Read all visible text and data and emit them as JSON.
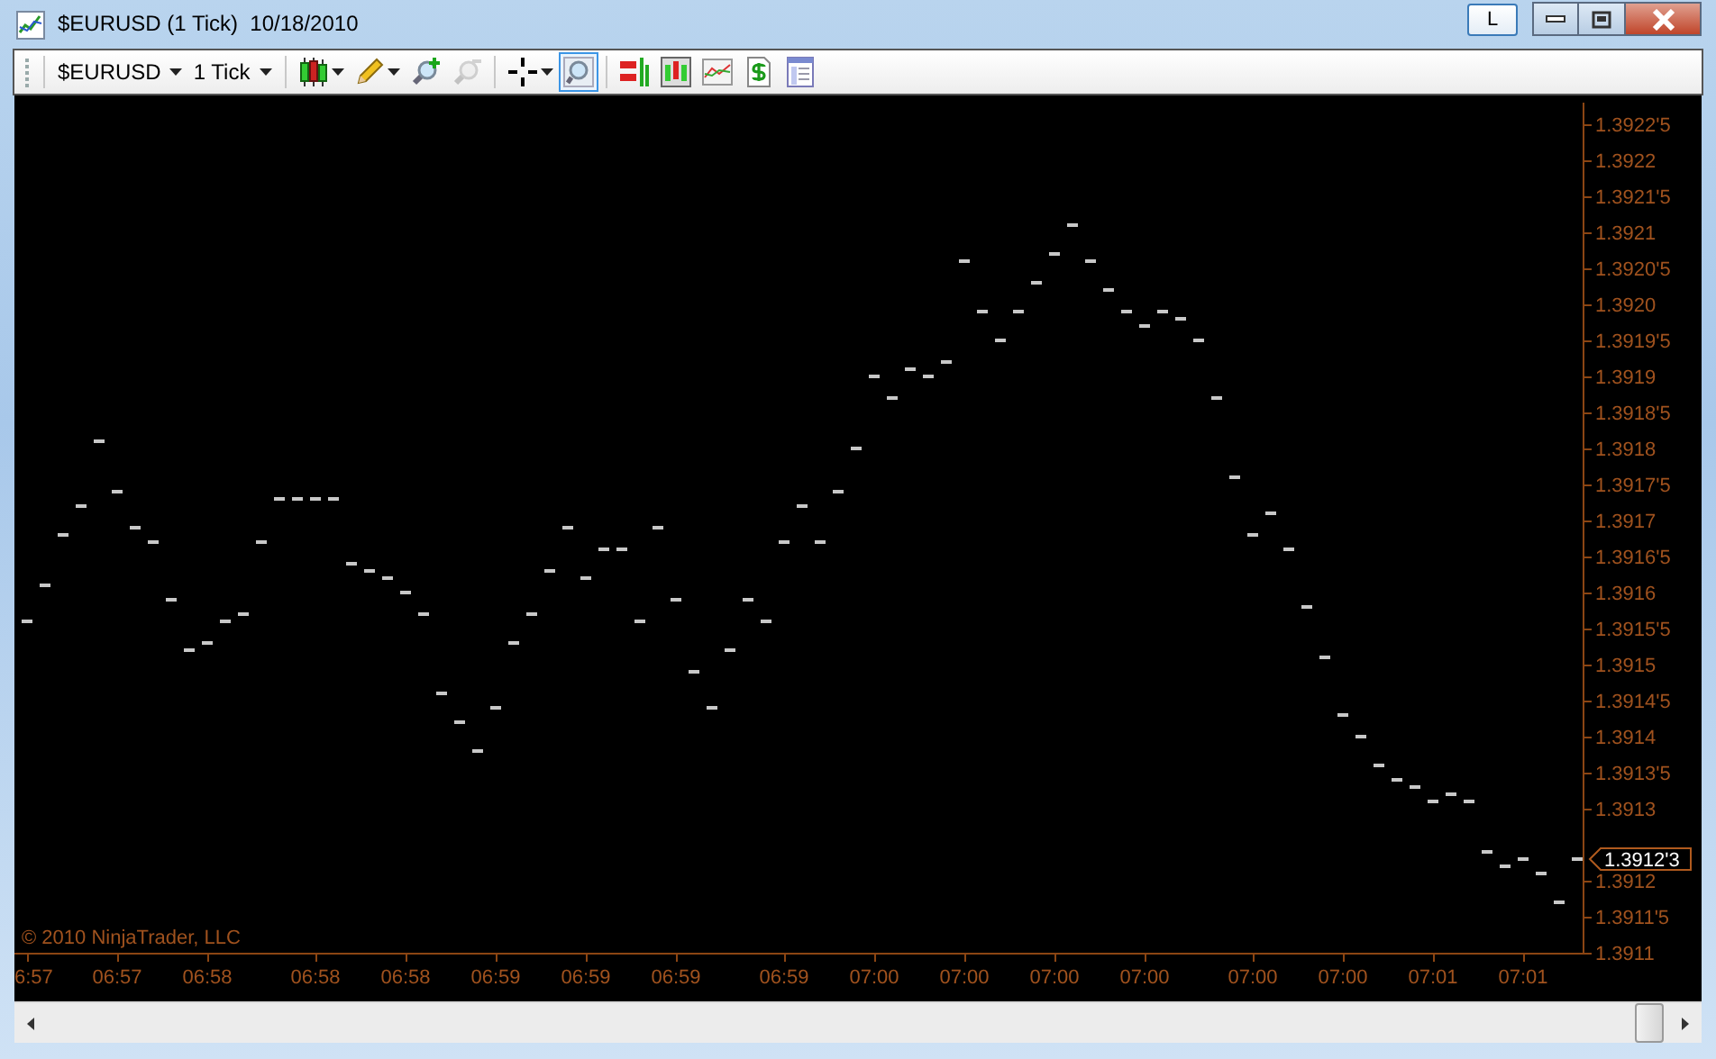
{
  "window": {
    "title": "$EURUSD (1 Tick)  10/18/2010",
    "link_button": "L"
  },
  "toolbar": {
    "instrument": "$EURUSD",
    "interval": "1 Tick",
    "tools": [
      {
        "kind": "candles",
        "menu": true,
        "disabled": false,
        "selected": false,
        "separator_before": true
      },
      {
        "kind": "pencil",
        "menu": true,
        "disabled": false,
        "selected": false,
        "separator_before": false
      },
      {
        "kind": "zoom-in",
        "menu": false,
        "disabled": false,
        "selected": false,
        "separator_before": false
      },
      {
        "kind": "zoom-out",
        "menu": false,
        "disabled": true,
        "selected": false,
        "separator_before": false
      },
      {
        "kind": "crosshair",
        "menu": true,
        "disabled": false,
        "selected": false,
        "separator_before": true
      },
      {
        "kind": "magnifier",
        "menu": false,
        "disabled": false,
        "selected": true,
        "separator_before": false
      },
      {
        "kind": "indicators",
        "menu": false,
        "disabled": false,
        "selected": false,
        "separator_before": true
      },
      {
        "kind": "strategies",
        "menu": false,
        "disabled": false,
        "selected": false,
        "separator_before": false
      },
      {
        "kind": "linechart",
        "menu": false,
        "disabled": false,
        "selected": false,
        "separator_before": false
      },
      {
        "kind": "dollar",
        "menu": false,
        "disabled": false,
        "selected": false,
        "separator_before": false
      },
      {
        "kind": "properties",
        "menu": false,
        "disabled": false,
        "selected": false,
        "separator_before": false
      }
    ]
  },
  "chart": {
    "copyright": "© 2010 NinjaTrader, LLC",
    "chart_data": {
      "type": "scatter",
      "ylim": [
        1.3911,
        1.39228
      ],
      "categories": [
        "6:57",
        null,
        null,
        null,
        null,
        "06:57",
        null,
        null,
        null,
        null,
        "06:58",
        null,
        null,
        null,
        null,
        null,
        "06:58",
        null,
        null,
        null,
        null,
        "06:58",
        null,
        null,
        null,
        null,
        "06:59",
        null,
        null,
        null,
        null,
        "06:59",
        null,
        null,
        null,
        null,
        "06:59",
        null,
        null,
        null,
        null,
        null,
        "06:59",
        null,
        null,
        null,
        null,
        "07:00",
        null,
        null,
        null,
        null,
        "07:00",
        null,
        null,
        null,
        null,
        "07:00",
        null,
        null,
        null,
        null,
        "07:00",
        null,
        null,
        null,
        null,
        null,
        "07:00",
        null,
        null,
        null,
        null,
        "07:00",
        null,
        null,
        null,
        null,
        "07:01",
        null,
        null,
        null,
        null,
        "07:01",
        null,
        null,
        null
      ],
      "yticks": [
        {
          "value": 1.39225,
          "label": "1.3922'5"
        },
        {
          "value": 1.3922,
          "label": "1.3922"
        },
        {
          "value": 1.39215,
          "label": "1.3921'5"
        },
        {
          "value": 1.3921,
          "label": "1.3921"
        },
        {
          "value": 1.39205,
          "label": "1.3920'5"
        },
        {
          "value": 1.392,
          "label": "1.3920"
        },
        {
          "value": 1.39195,
          "label": "1.3919'5"
        },
        {
          "value": 1.3919,
          "label": "1.3919"
        },
        {
          "value": 1.39185,
          "label": "1.3918'5"
        },
        {
          "value": 1.3918,
          "label": "1.3918"
        },
        {
          "value": 1.39175,
          "label": "1.3917'5"
        },
        {
          "value": 1.3917,
          "label": "1.3917"
        },
        {
          "value": 1.39165,
          "label": "1.3916'5"
        },
        {
          "value": 1.3916,
          "label": "1.3916"
        },
        {
          "value": 1.39155,
          "label": "1.3915'5"
        },
        {
          "value": 1.3915,
          "label": "1.3915"
        },
        {
          "value": 1.39145,
          "label": "1.3914'5"
        },
        {
          "value": 1.3914,
          "label": "1.3914"
        },
        {
          "value": 1.39135,
          "label": "1.3913'5"
        },
        {
          "value": 1.3913,
          "label": "1.3913"
        },
        {
          "value": 1.3912,
          "label": "1.3912"
        },
        {
          "value": 1.39115,
          "label": "1.3911'5"
        },
        {
          "value": 1.3911,
          "label": "1.3911"
        }
      ],
      "annotations": [
        "1.3912'3"
      ],
      "series": [
        {
          "color": "#c8c8c8",
          "values": [
            1.39156,
            1.39161,
            1.39168,
            1.39172,
            1.39181,
            1.39174,
            1.39169,
            1.39167,
            1.39159,
            1.39152,
            1.39153,
            1.39156,
            1.39157,
            1.39167,
            1.39173,
            1.39173,
            1.39173,
            1.39173,
            1.39164,
            1.39163,
            1.39162,
            1.3916,
            1.39157,
            1.39146,
            1.39142,
            1.39138,
            1.39144,
            1.39153,
            1.39157,
            1.39163,
            1.39169,
            1.39162,
            1.39166,
            1.39166,
            1.39156,
            1.39169,
            1.39159,
            1.39149,
            1.39144,
            1.39152,
            1.39159,
            1.39156,
            1.39167,
            1.39172,
            1.39167,
            1.39174,
            1.3918,
            1.3919,
            1.39187,
            1.39191,
            1.3919,
            1.39192,
            1.39206,
            1.39199,
            1.39195,
            1.39199,
            1.39203,
            1.39207,
            1.39211,
            1.39206,
            1.39202,
            1.39199,
            1.39197,
            1.39199,
            1.39198,
            1.39195,
            1.39187,
            1.39176,
            1.39168,
            1.39171,
            1.39166,
            1.39158,
            1.39151,
            1.39143,
            1.3914,
            1.39136,
            1.39134,
            1.39133,
            1.39131,
            1.39132,
            1.39131,
            1.39124,
            1.39122,
            1.39123,
            1.39121,
            1.39117,
            1.39123
          ]
        }
      ]
    }
  }
}
